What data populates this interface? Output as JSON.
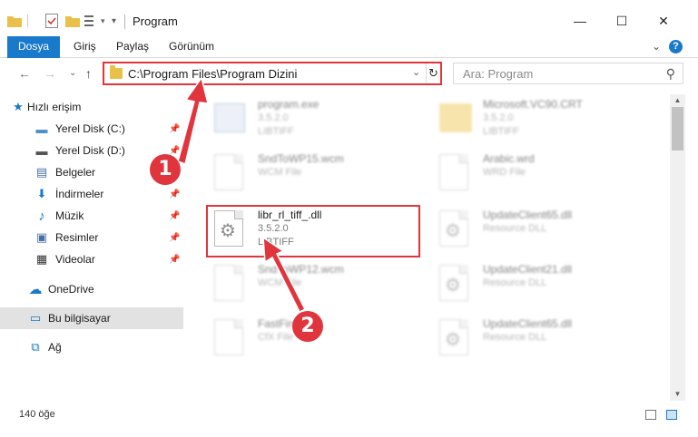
{
  "window": {
    "title": "Program",
    "minimize": "—",
    "maximize": "☐",
    "close": "✕"
  },
  "ribbon": {
    "tabs": [
      "Dosya",
      "Giriş",
      "Paylaş",
      "Görünüm"
    ],
    "expand": "⌄",
    "help": "?"
  },
  "nav": {
    "back": "←",
    "forward": "→",
    "recent": "⌄",
    "up": "↑",
    "address": "C:\\Program Files\\Program Dizini",
    "address_dropdown": "⌄",
    "refresh": "↻",
    "search_placeholder": "Ara: Program",
    "search_icon": "⚲"
  },
  "sidebar": {
    "items": [
      {
        "label": "Hızlı erişim",
        "icon": "star-icon",
        "glyph": "★",
        "color": "#1979ca",
        "pinned": false
      },
      {
        "label": "Yerel Disk (C:)",
        "icon": "drive-icon",
        "glyph": "▬",
        "color": "#4a90c9",
        "pinned": true
      },
      {
        "label": "Yerel Disk (D:)",
        "icon": "drive-icon",
        "glyph": "▬",
        "color": "#555555",
        "pinned": true
      },
      {
        "label": "Belgeler",
        "icon": "documents-icon",
        "glyph": "▤",
        "color": "#4a6ea8",
        "pinned": true
      },
      {
        "label": "İndirmeler",
        "icon": "download-icon",
        "glyph": "⬇",
        "color": "#1979ca",
        "pinned": true
      },
      {
        "label": "Müzik",
        "icon": "music-icon",
        "glyph": "♪",
        "color": "#1979ca",
        "pinned": true
      },
      {
        "label": "Resimler",
        "icon": "pictures-icon",
        "glyph": "▣",
        "color": "#4a6ea8",
        "pinned": true
      },
      {
        "label": "Videolar",
        "icon": "video-icon",
        "glyph": "▦",
        "color": "#333333",
        "pinned": true
      },
      {
        "label": "OneDrive",
        "icon": "cloud-icon",
        "glyph": "☁",
        "color": "#1979ca",
        "pinned": false
      },
      {
        "label": "Bu bilgisayar",
        "icon": "computer-icon",
        "glyph": "▭",
        "color": "#1979ca",
        "pinned": false
      },
      {
        "label": "Ağ",
        "icon": "network-icon",
        "glyph": "⧉",
        "color": "#1979ca",
        "pinned": false
      }
    ],
    "pin_glyph": "📌"
  },
  "files": [
    {
      "name": "program.exe",
      "version": "3.5.2.0",
      "desc": "LIBTIFF",
      "kind": "exe"
    },
    {
      "name": "Microsoft.VC90.CRT",
      "version": "3.5.2.0",
      "desc": "LIBTIFF",
      "kind": "folder"
    },
    {
      "name": "SndToWP15.wcm",
      "version": "WCM File",
      "desc": "",
      "kind": "doc"
    },
    {
      "name": "Arabic.wrd",
      "version": "WRD File",
      "desc": "",
      "kind": "doc"
    },
    {
      "name": "libr_rl_tiff_.dll",
      "version": "3.5.2.0",
      "desc": "LIBTIFF",
      "kind": "dll"
    },
    {
      "name": "UpdateClient65.dll",
      "version": "Resource DLL",
      "desc": "",
      "kind": "dll"
    },
    {
      "name": "SndToWP12.wcm",
      "version": "WCM File",
      "desc": "",
      "kind": "doc"
    },
    {
      "name": "UpdateClient21.dll",
      "version": "Resource DLL",
      "desc": "",
      "kind": "dll"
    },
    {
      "name": "FastFind.cfx",
      "version": "CfX File",
      "desc": "",
      "kind": "doc"
    },
    {
      "name": "UpdateClient65.dll",
      "version": "Resource DLL",
      "desc": "",
      "kind": "dll"
    }
  ],
  "status": {
    "count": "140 öğe"
  },
  "annotations": {
    "step1": "1",
    "step2": "2",
    "accent": "#e0353d"
  }
}
